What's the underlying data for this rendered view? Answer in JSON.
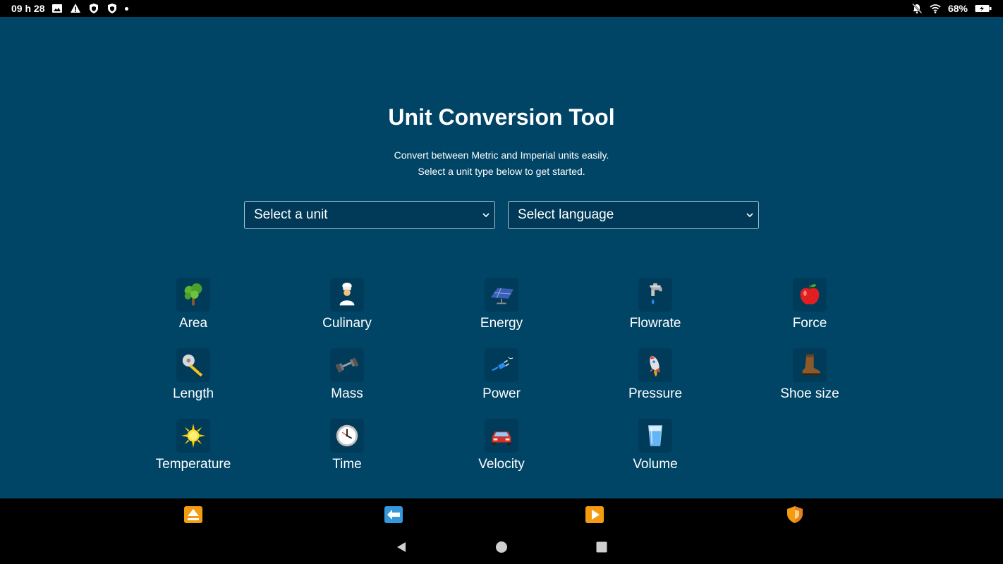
{
  "status_bar": {
    "time": "09 h 28",
    "battery": "68%",
    "left_icons": [
      "image-icon",
      "warning-icon",
      "shield-icon",
      "shield-icon",
      "dot-icon"
    ],
    "right_icons": [
      "notifications-off-icon",
      "wifi-icon",
      "battery-charging-icon"
    ]
  },
  "header": {
    "title": "Unit Conversion Tool",
    "subtitle_line1": "Convert between Metric and Imperial units easily.",
    "subtitle_line2": "Select a unit type below to get started."
  },
  "selects": {
    "unit": "Select a unit",
    "language": "Select language"
  },
  "categories": [
    {
      "label": "Area",
      "icon": "tree-icon"
    },
    {
      "label": "Culinary",
      "icon": "chef-icon"
    },
    {
      "label": "Energy",
      "icon": "solar-panel-icon"
    },
    {
      "label": "Flowrate",
      "icon": "faucet-icon"
    },
    {
      "label": "Force",
      "icon": "apple-icon"
    },
    {
      "label": "Length",
      "icon": "tape-measure-icon"
    },
    {
      "label": "Mass",
      "icon": "dumbbell-icon"
    },
    {
      "label": "Power",
      "icon": "plug-icon"
    },
    {
      "label": "Pressure",
      "icon": "rocket-icon"
    },
    {
      "label": "Shoe size",
      "icon": "boot-icon"
    },
    {
      "label": "Temperature",
      "icon": "sun-icon"
    },
    {
      "label": "Time",
      "icon": "clock-icon"
    },
    {
      "label": "Velocity",
      "icon": "car-icon"
    },
    {
      "label": "Volume",
      "icon": "glass-icon"
    }
  ],
  "nav_apps": [
    "eject-icon",
    "back-arrow-icon",
    "play-icon",
    "shield-icon"
  ],
  "colors": {
    "background": "#004466",
    "select_bg": "#003a58",
    "tile_bg": "#013b5a",
    "bar": "#000000",
    "accent_orange": "#f39c12",
    "accent_blue": "#3498db"
  }
}
